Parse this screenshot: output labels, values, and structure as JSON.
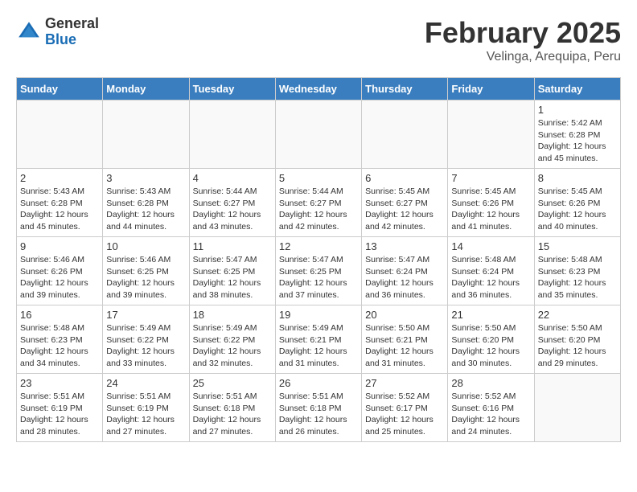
{
  "header": {
    "logo_general": "General",
    "logo_blue": "Blue",
    "month_title": "February 2025",
    "location": "Velinga, Arequipa, Peru"
  },
  "days_of_week": [
    "Sunday",
    "Monday",
    "Tuesday",
    "Wednesday",
    "Thursday",
    "Friday",
    "Saturday"
  ],
  "weeks": [
    [
      {
        "day": "",
        "info": ""
      },
      {
        "day": "",
        "info": ""
      },
      {
        "day": "",
        "info": ""
      },
      {
        "day": "",
        "info": ""
      },
      {
        "day": "",
        "info": ""
      },
      {
        "day": "",
        "info": ""
      },
      {
        "day": "1",
        "info": "Sunrise: 5:42 AM\nSunset: 6:28 PM\nDaylight: 12 hours\nand 45 minutes."
      }
    ],
    [
      {
        "day": "2",
        "info": "Sunrise: 5:43 AM\nSunset: 6:28 PM\nDaylight: 12 hours\nand 45 minutes."
      },
      {
        "day": "3",
        "info": "Sunrise: 5:43 AM\nSunset: 6:28 PM\nDaylight: 12 hours\nand 44 minutes."
      },
      {
        "day": "4",
        "info": "Sunrise: 5:44 AM\nSunset: 6:27 PM\nDaylight: 12 hours\nand 43 minutes."
      },
      {
        "day": "5",
        "info": "Sunrise: 5:44 AM\nSunset: 6:27 PM\nDaylight: 12 hours\nand 42 minutes."
      },
      {
        "day": "6",
        "info": "Sunrise: 5:45 AM\nSunset: 6:27 PM\nDaylight: 12 hours\nand 42 minutes."
      },
      {
        "day": "7",
        "info": "Sunrise: 5:45 AM\nSunset: 6:26 PM\nDaylight: 12 hours\nand 41 minutes."
      },
      {
        "day": "8",
        "info": "Sunrise: 5:45 AM\nSunset: 6:26 PM\nDaylight: 12 hours\nand 40 minutes."
      }
    ],
    [
      {
        "day": "9",
        "info": "Sunrise: 5:46 AM\nSunset: 6:26 PM\nDaylight: 12 hours\nand 39 minutes."
      },
      {
        "day": "10",
        "info": "Sunrise: 5:46 AM\nSunset: 6:25 PM\nDaylight: 12 hours\nand 39 minutes."
      },
      {
        "day": "11",
        "info": "Sunrise: 5:47 AM\nSunset: 6:25 PM\nDaylight: 12 hours\nand 38 minutes."
      },
      {
        "day": "12",
        "info": "Sunrise: 5:47 AM\nSunset: 6:25 PM\nDaylight: 12 hours\nand 37 minutes."
      },
      {
        "day": "13",
        "info": "Sunrise: 5:47 AM\nSunset: 6:24 PM\nDaylight: 12 hours\nand 36 minutes."
      },
      {
        "day": "14",
        "info": "Sunrise: 5:48 AM\nSunset: 6:24 PM\nDaylight: 12 hours\nand 36 minutes."
      },
      {
        "day": "15",
        "info": "Sunrise: 5:48 AM\nSunset: 6:23 PM\nDaylight: 12 hours\nand 35 minutes."
      }
    ],
    [
      {
        "day": "16",
        "info": "Sunrise: 5:48 AM\nSunset: 6:23 PM\nDaylight: 12 hours\nand 34 minutes."
      },
      {
        "day": "17",
        "info": "Sunrise: 5:49 AM\nSunset: 6:22 PM\nDaylight: 12 hours\nand 33 minutes."
      },
      {
        "day": "18",
        "info": "Sunrise: 5:49 AM\nSunset: 6:22 PM\nDaylight: 12 hours\nand 32 minutes."
      },
      {
        "day": "19",
        "info": "Sunrise: 5:49 AM\nSunset: 6:21 PM\nDaylight: 12 hours\nand 31 minutes."
      },
      {
        "day": "20",
        "info": "Sunrise: 5:50 AM\nSunset: 6:21 PM\nDaylight: 12 hours\nand 31 minutes."
      },
      {
        "day": "21",
        "info": "Sunrise: 5:50 AM\nSunset: 6:20 PM\nDaylight: 12 hours\nand 30 minutes."
      },
      {
        "day": "22",
        "info": "Sunrise: 5:50 AM\nSunset: 6:20 PM\nDaylight: 12 hours\nand 29 minutes."
      }
    ],
    [
      {
        "day": "23",
        "info": "Sunrise: 5:51 AM\nSunset: 6:19 PM\nDaylight: 12 hours\nand 28 minutes."
      },
      {
        "day": "24",
        "info": "Sunrise: 5:51 AM\nSunset: 6:19 PM\nDaylight: 12 hours\nand 27 minutes."
      },
      {
        "day": "25",
        "info": "Sunrise: 5:51 AM\nSunset: 6:18 PM\nDaylight: 12 hours\nand 27 minutes."
      },
      {
        "day": "26",
        "info": "Sunrise: 5:51 AM\nSunset: 6:18 PM\nDaylight: 12 hours\nand 26 minutes."
      },
      {
        "day": "27",
        "info": "Sunrise: 5:52 AM\nSunset: 6:17 PM\nDaylight: 12 hours\nand 25 minutes."
      },
      {
        "day": "28",
        "info": "Sunrise: 5:52 AM\nSunset: 6:16 PM\nDaylight: 12 hours\nand 24 minutes."
      },
      {
        "day": "",
        "info": ""
      }
    ]
  ]
}
